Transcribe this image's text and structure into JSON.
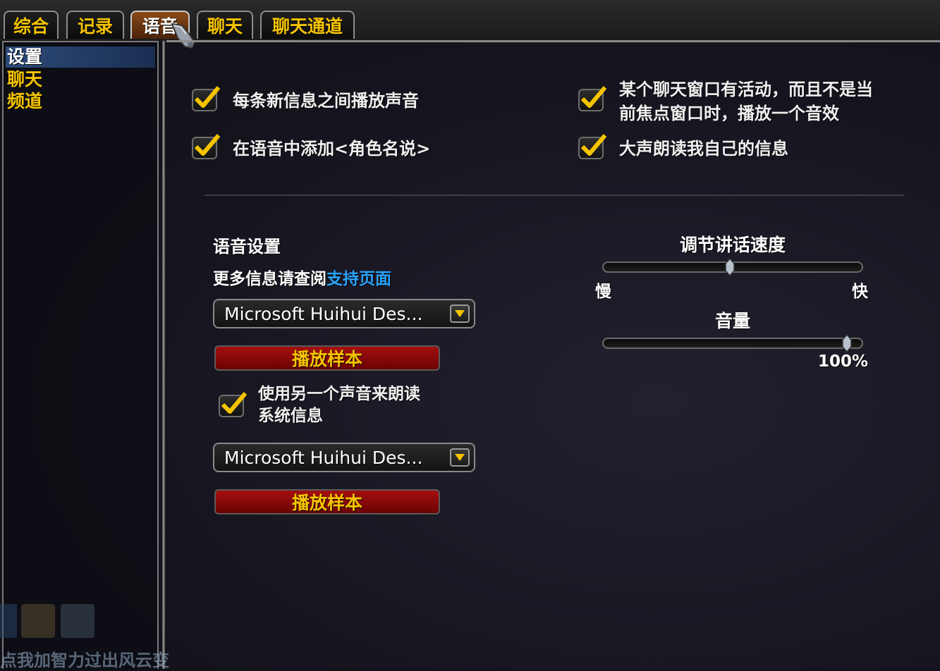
{
  "tabs": [
    {
      "label": "综合"
    },
    {
      "label": "记录"
    },
    {
      "label": "语音"
    },
    {
      "label": "聊天"
    },
    {
      "label": "聊天通道"
    }
  ],
  "sidebar": {
    "items": [
      {
        "label": "设置"
      },
      {
        "label": "聊天"
      },
      {
        "label": "频道"
      }
    ]
  },
  "options": {
    "play_sound_each_msg": {
      "label": "每条新信息之间播放声音",
      "checked": true
    },
    "add_name_says": {
      "label": "在语音中添加<角色名说>",
      "checked": true
    },
    "window_activity": {
      "label_line1": "某个聊天窗口有活动，而且不是当",
      "label_line2": "前焦点窗口时，播放一个音效",
      "checked": true
    },
    "read_own_messages": {
      "label": "大声朗读我自己的信息",
      "checked": true
    }
  },
  "voice": {
    "heading": "语音设置",
    "more_info": "更多信息请查阅",
    "support_link": "支持页面",
    "voice1": "Microsoft Huihui Des...",
    "voice2": "Microsoft Huihui Des...",
    "play_sample_1": "播放样本",
    "play_sample_2": "播放样本",
    "alt_voice": {
      "label_line1": "使用另一个声音来朗读",
      "label_line2": "系统信息",
      "checked": true
    }
  },
  "sliders": {
    "speed": {
      "title": "调节讲话速度",
      "min_label": "慢",
      "max_label": "快",
      "value": 0.5
    },
    "volume": {
      "title": "音量",
      "value_label": "100%",
      "value": 1.0
    }
  },
  "background_hud": {
    "text": "点我加智力过出风云变"
  },
  "colors": {
    "accent_gold": "#f6c400",
    "link_blue": "#2aa4ff",
    "button_red": "#a50f0f"
  }
}
